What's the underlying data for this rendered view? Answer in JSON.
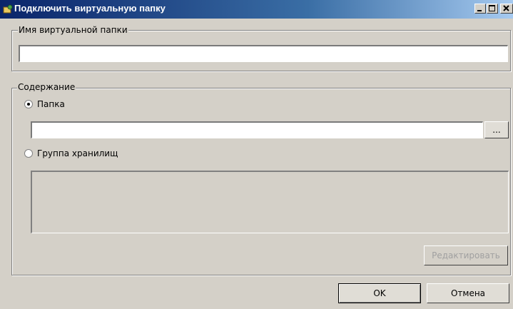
{
  "window": {
    "title": "Подключить виртуальную папку",
    "controls": {
      "minimize_icon": "minimize-icon",
      "maximize_icon": "maximize-icon",
      "close_icon": "close-icon"
    }
  },
  "name_group": {
    "legend": "Имя виртуальной папки",
    "input_value": ""
  },
  "content_group": {
    "legend": "Содержание",
    "folder_radio": {
      "label": "Папка",
      "checked": true
    },
    "folder_input_value": "",
    "browse_button": "...",
    "storage_group_radio": {
      "label": "Группа хранилищ",
      "checked": false
    },
    "edit_button": "Редактировать"
  },
  "footer": {
    "ok_button": "OK",
    "cancel_button": "Отмена"
  }
}
